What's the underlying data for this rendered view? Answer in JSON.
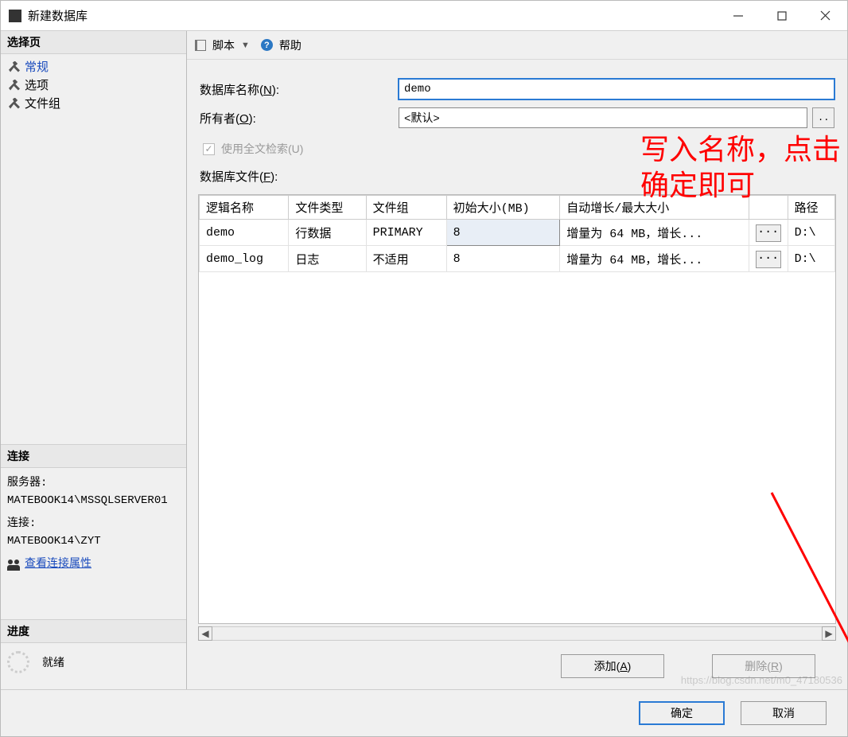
{
  "window": {
    "title": "新建数据库"
  },
  "toolbar": {
    "script_label": "脚本",
    "help_label": "帮助"
  },
  "sidebar": {
    "select_page_title": "选择页",
    "pages": [
      {
        "label": "常规",
        "selected": true
      },
      {
        "label": "选项",
        "selected": false
      },
      {
        "label": "文件组",
        "selected": false
      }
    ],
    "connection": {
      "title": "连接",
      "server_label": "服务器:",
      "server_value": "MATEBOOK14\\MSSQLSERVER01",
      "conn_label": "连接:",
      "conn_value": "MATEBOOK14\\ZYT",
      "view_props": "查看连接属性"
    },
    "progress": {
      "title": "进度",
      "status": "就绪"
    }
  },
  "form": {
    "db_name_label_pre": "数据库名称(",
    "db_name_label_hot": "N",
    "db_name_label_post": "):",
    "db_name_value": "demo",
    "owner_label_pre": "所有者(",
    "owner_label_hot": "O",
    "owner_label_post": "):",
    "owner_value": "<默认>",
    "fulltext_label_pre": "使用全文检索(",
    "fulltext_label_hot": "U",
    "fulltext_label_post": ")",
    "files_label_pre": "数据库文件(",
    "files_label_hot": "F",
    "files_label_post": "):",
    "browse_button": ".."
  },
  "grid": {
    "headers": {
      "logical_name": "逻辑名称",
      "file_type": "文件类型",
      "filegroup": "文件组",
      "initial_size": "初始大小(MB)",
      "autogrowth": "自动增长/最大大小",
      "path": "路径"
    },
    "rows": [
      {
        "logical_name": "demo",
        "file_type": "行数据",
        "filegroup": "PRIMARY",
        "initial_size": "8",
        "autogrowth": "增量为 64 MB，增长...",
        "path": "D:\\"
      },
      {
        "logical_name": "demo_log",
        "file_type": "日志",
        "filegroup": "不适用",
        "initial_size": "8",
        "autogrowth": "增量为 64 MB，增长...",
        "path": "D:\\"
      }
    ],
    "dots": "..."
  },
  "grid_buttons": {
    "add_pre": "添加(",
    "add_hot": "A",
    "add_post": ")",
    "remove_pre": "删除(",
    "remove_hot": "R",
    "remove_post": ")"
  },
  "footer": {
    "ok": "确定",
    "cancel": "取消"
  },
  "annotation": {
    "line1": "写入名称，点击",
    "line2": "确定即可"
  },
  "watermark": "https://blog.csdn.net/m0_47180536"
}
